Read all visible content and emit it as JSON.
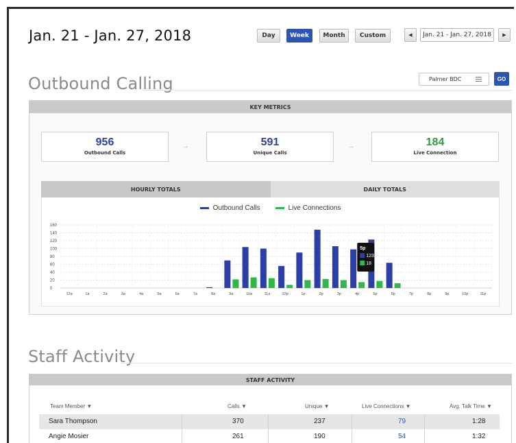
{
  "header": {
    "date_range_title": "Jan. 21 - Jan. 27, 2018",
    "period_buttons": [
      {
        "label": "Day",
        "active": false
      },
      {
        "label": "Week",
        "active": true
      },
      {
        "label": "Month",
        "active": false
      },
      {
        "label": "Custom",
        "active": false
      }
    ],
    "prev_icon": "caret-left-icon",
    "next_icon": "caret-right-icon",
    "range_label": "Jan. 21 - Jan. 27, 2018"
  },
  "outbound": {
    "title": "Outbound Calling",
    "filter": {
      "selected": "Palmer BDC",
      "icon": "list-icon"
    },
    "go_label": "GO",
    "panel_title": "KEY METRICS",
    "metrics": [
      {
        "value": "956",
        "label": "Outbound Calls",
        "color": "#2d3fa0"
      },
      {
        "value": "591",
        "label": "Unique Calls",
        "color": "#2d3fa0"
      },
      {
        "value": "184",
        "label": "Live Connection",
        "color": "#2e9b3f"
      }
    ],
    "arrow_icon": "arrow-right-icon",
    "tabs": [
      {
        "label": "HOURLY TOTALS",
        "active": true
      },
      {
        "label": "DAILY TOTALS",
        "active": false
      }
    ]
  },
  "chart_data": {
    "type": "bar",
    "categories": [
      "12a",
      "1a",
      "2a",
      "3a",
      "4a",
      "5a",
      "6a",
      "7a",
      "8a",
      "9a",
      "10a",
      "11a",
      "12p",
      "1p",
      "2p",
      "3p",
      "4p",
      "5p",
      "6p",
      "7p",
      "8p",
      "9p",
      "10p",
      "11p"
    ],
    "series": [
      {
        "name": "Outbound Calls",
        "color": "#2b3fa6",
        "values": [
          0,
          0,
          0,
          0,
          0,
          0,
          0,
          0,
          2,
          70,
          104,
          100,
          56,
          90,
          148,
          106,
          98,
          123,
          64,
          0,
          0,
          0,
          0,
          0
        ]
      },
      {
        "name": "Live Connections",
        "color": "#2eb84a",
        "values": [
          0,
          0,
          0,
          0,
          0,
          0,
          0,
          0,
          0,
          22,
          27,
          25,
          8,
          20,
          23,
          20,
          15,
          18,
          12,
          0,
          0,
          0,
          0,
          0
        ]
      }
    ],
    "yticks": [
      0,
      20,
      40,
      60,
      80,
      100,
      120,
      140,
      160
    ],
    "ylim": [
      0,
      160
    ],
    "grid": true,
    "legend": "top-center",
    "tooltip": {
      "category": "5p",
      "values": [
        "123",
        "18"
      ]
    }
  },
  "staff": {
    "title": "Staff Activity",
    "panel_title": "STAFF ACTIVITY",
    "columns": [
      {
        "label": "Team Member ▼"
      },
      {
        "label": "Calls ▼"
      },
      {
        "label": "Unique ▼"
      },
      {
        "label": "Live Connections ▼"
      },
      {
        "label": "Avg. Talk Time ▼"
      }
    ],
    "rows": [
      {
        "name": "Sara Thompson",
        "calls": "370",
        "unique": "237",
        "live": "79",
        "talk": "1:28"
      },
      {
        "name": "Angie Mosier",
        "calls": "261",
        "unique": "190",
        "live": "54",
        "talk": "1:32"
      }
    ],
    "link_color": "#2d53b3"
  }
}
